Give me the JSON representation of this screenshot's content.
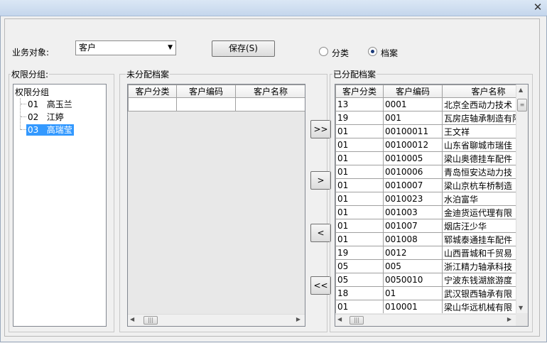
{
  "window": {
    "close_icon": "close-icon"
  },
  "toolbar": {
    "business_label": "业务对象:",
    "business_value": "客户",
    "save_label": "保存(S)",
    "radio_category": "分类",
    "radio_archive": "档案",
    "selected_radio": "archive"
  },
  "perm": {
    "title": "权限分组:",
    "root": "权限分组",
    "groups": [
      {
        "code": "01",
        "name": "高玉兰",
        "selected": false
      },
      {
        "code": "02",
        "name": "江婷",
        "selected": false
      },
      {
        "code": "03",
        "name": "高瑞莹",
        "selected": true
      }
    ]
  },
  "unassigned": {
    "title": "未分配档案",
    "columns": [
      "客户分类",
      "客户编码",
      "客户名称"
    ]
  },
  "assigned": {
    "title": "已分配档案",
    "columns": [
      "客户分类",
      "客户编码",
      "客户名称"
    ],
    "rows": [
      [
        "13",
        "0001",
        "北京全西动力技术"
      ],
      [
        "19",
        "001",
        "瓦房店轴承制造有限"
      ],
      [
        "01",
        "00100011",
        "王文祥"
      ],
      [
        "01",
        "00100012",
        "山东省聊城市瑞佳"
      ],
      [
        "01",
        "0010005",
        "梁山奥德挂车配件"
      ],
      [
        "01",
        "0010006",
        "青岛恒安达动力技"
      ],
      [
        "01",
        "0010007",
        "梁山京杭车桥制造"
      ],
      [
        "01",
        "0010023",
        "水泊富华"
      ],
      [
        "01",
        "001003",
        "金迪货运代理有限"
      ],
      [
        "01",
        "001007",
        "烟店汪少华"
      ],
      [
        "01",
        "001008",
        "郓城泰通挂车配件"
      ],
      [
        "19",
        "0012",
        "山西晋城和千贸易"
      ],
      [
        "05",
        "005",
        "浙江精力轴承科技"
      ],
      [
        "05",
        "0050010",
        "宁波东钱湖旅游度"
      ],
      [
        "18",
        "01",
        "武汉银西轴承有限"
      ],
      [
        "01",
        "010001",
        "梁山华远机械有限"
      ]
    ]
  },
  "buttons": {
    "move_all_right": ">>",
    "move_right": ">",
    "move_left": "<",
    "move_all_left": "<<"
  }
}
